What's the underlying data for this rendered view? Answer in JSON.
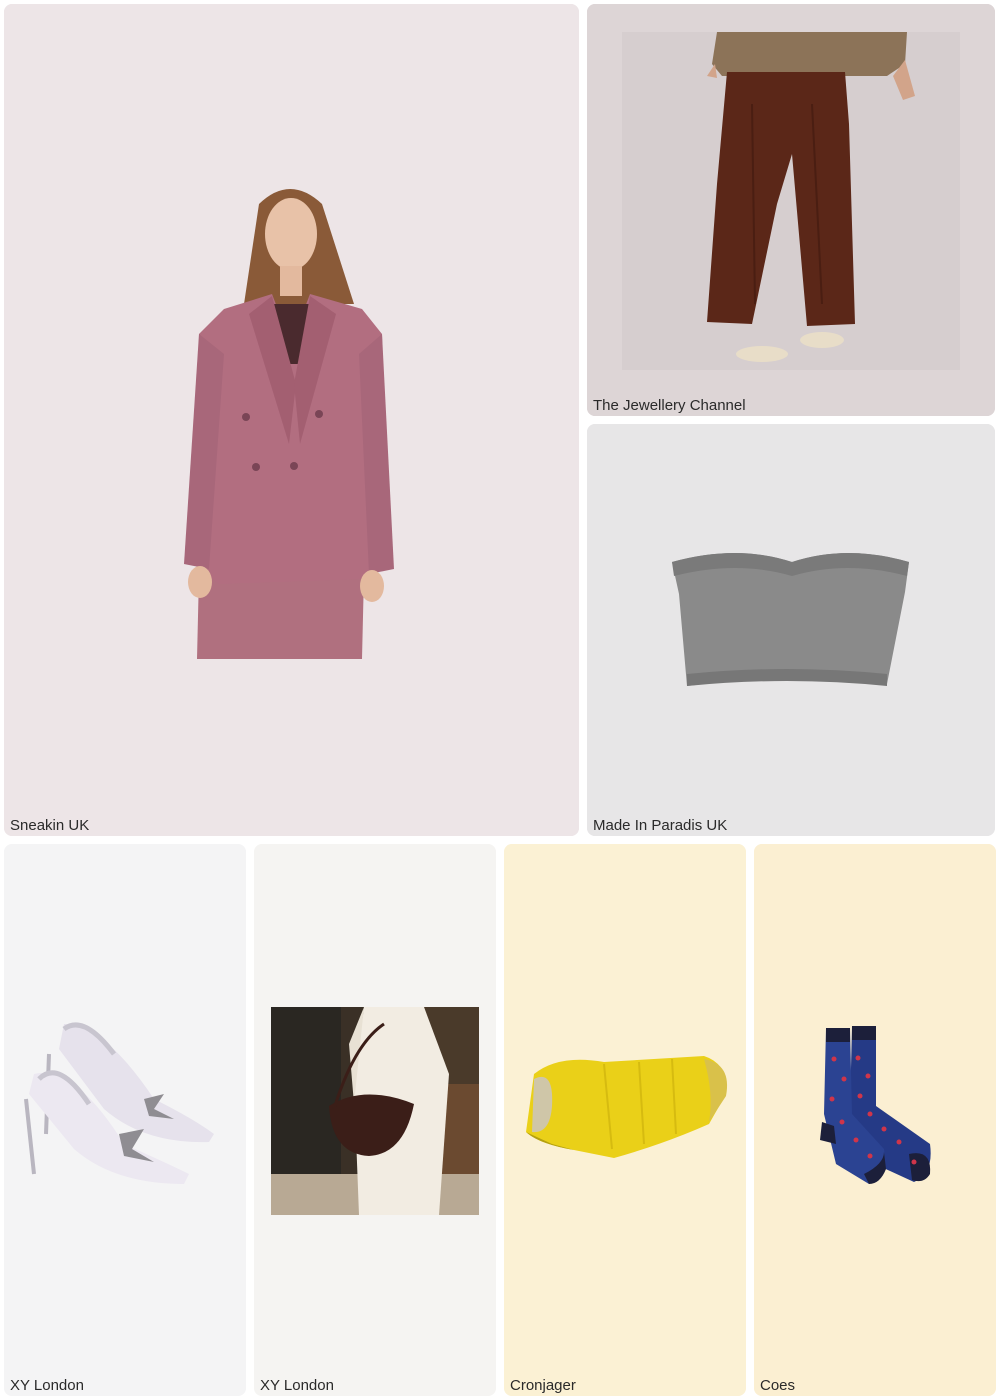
{
  "products": [
    {
      "seller": "Sneakin UK",
      "image": "pink-double-breasted-blazer-photo",
      "background": "#ede5e7"
    },
    {
      "seller": "The Jewellery Channel",
      "image": "brown-wide-leg-trousers-photo",
      "background": "#ddd5d6"
    },
    {
      "seller": "Made In Paradis UK",
      "image": "grey-bandeau-top-photo",
      "background": "#e7e6e7"
    },
    {
      "seller": "XY London",
      "image": "silver-bow-slingback-heels-photo",
      "background": "#f4f4f5"
    },
    {
      "seller": "XY London",
      "image": "brown-crescent-shoulder-bag-photo",
      "background": "#f5f4f2"
    },
    {
      "seller": "Cronjager",
      "image": "yellow-puffer-dog-coat-photo",
      "background": "#fbf1d4"
    },
    {
      "seller": "Coes",
      "image": "navy-heart-socks-photo",
      "background": "#fbefd2"
    }
  ]
}
